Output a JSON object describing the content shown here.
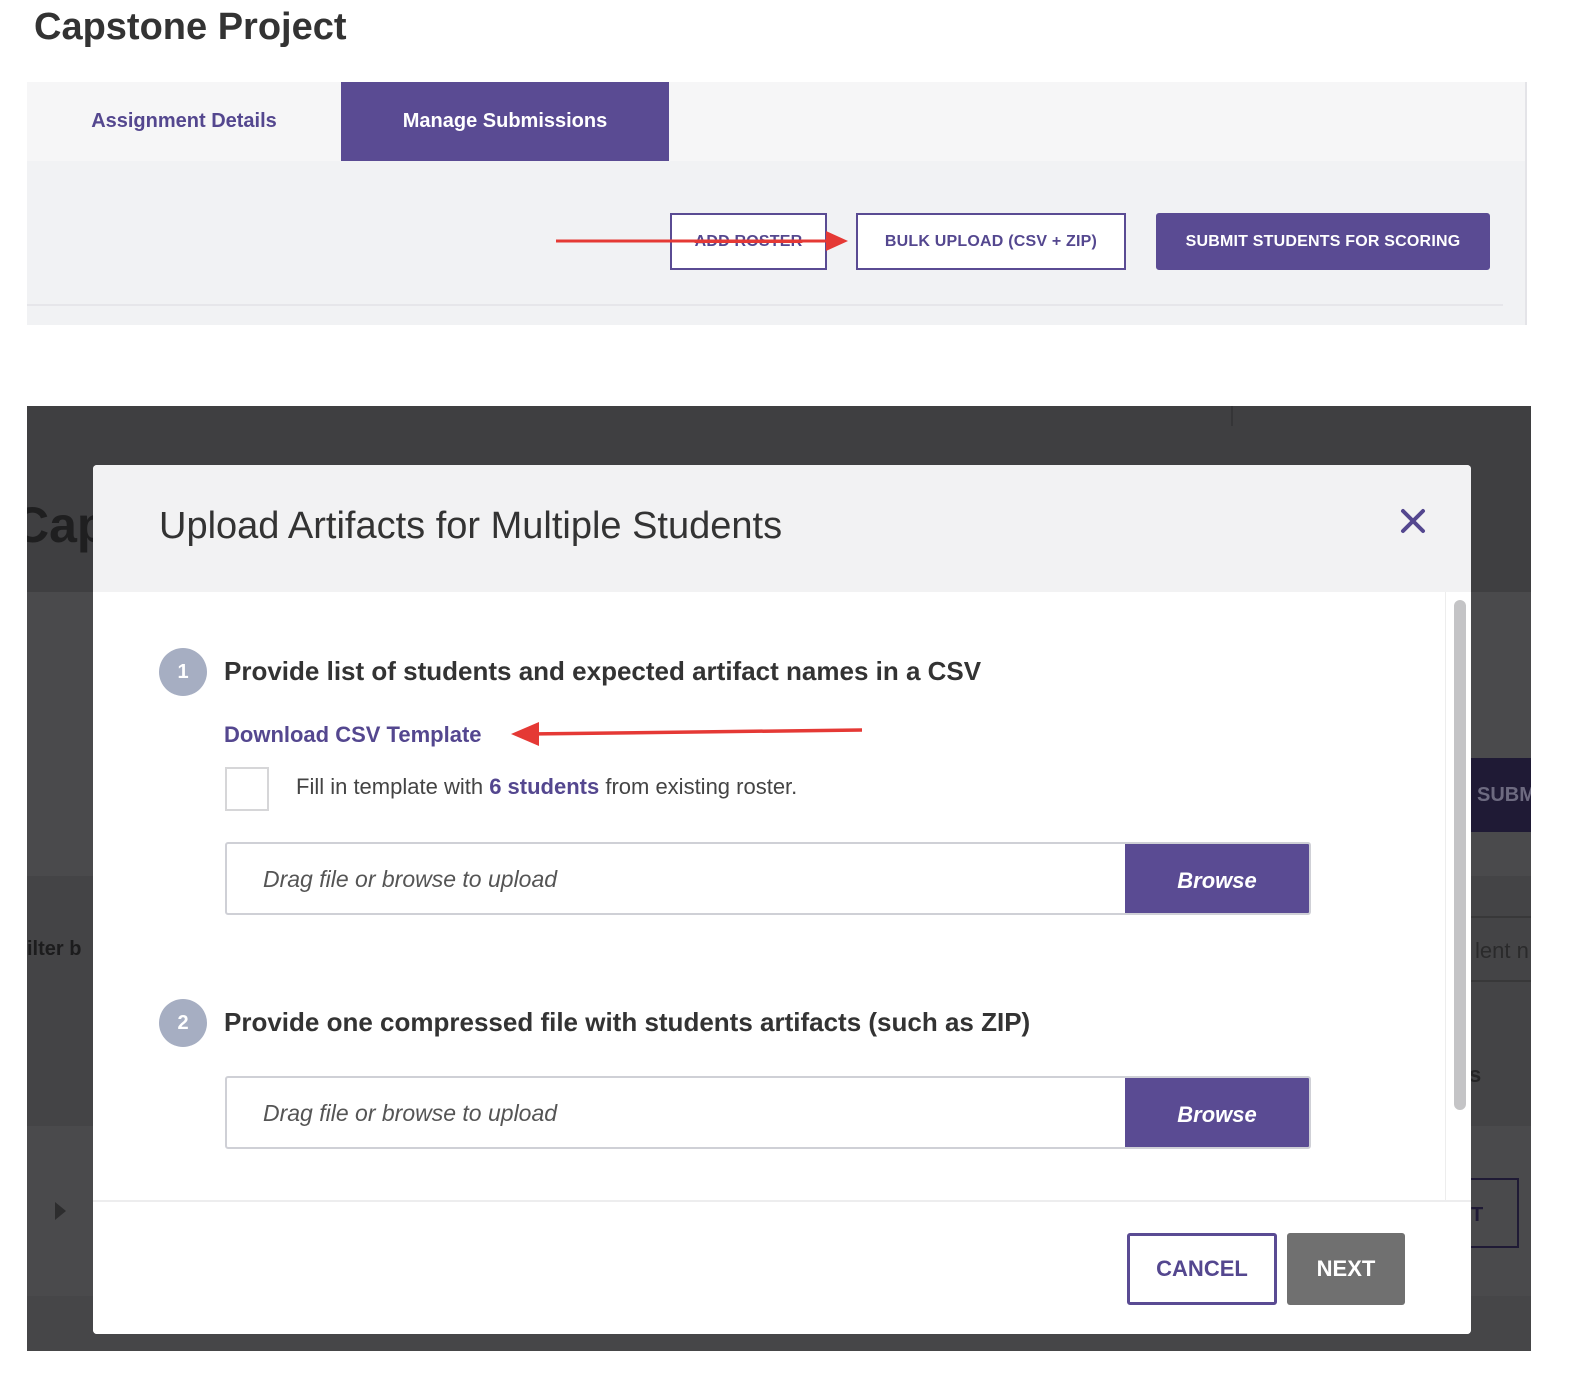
{
  "top": {
    "page_title": "Capstone Project",
    "tabs": [
      {
        "label": "Assignment Details"
      },
      {
        "label": "Manage Submissions"
      }
    ],
    "active_tab": "Manage Submissions",
    "toolbar": {
      "add_roster_label": "ADD ROSTER",
      "bulk_upload_label": "BULK UPLOAD (CSV + ZIP)",
      "submit_label": "SUBMIT STUDENTS FOR SCORING"
    }
  },
  "background": {
    "title_fragment": "Cap",
    "filter_fragment": "ilter b",
    "submit_fragment": "SUBM",
    "input_fragment": "lent n",
    "s_fragment": "s",
    "t_fragment": "T"
  },
  "modal": {
    "title": "Upload Artifacts for Multiple Students",
    "step1": {
      "number": "1",
      "text": "Provide list of students and expected artifact names in a CSV",
      "download_link": "Download CSV Template",
      "fill_prefix": "Fill in template with ",
      "fill_highlight": "6 students",
      "fill_suffix": " from existing roster.",
      "upload_placeholder": "Drag file or browse to upload",
      "browse_label": "Browse"
    },
    "step2": {
      "number": "2",
      "text": "Provide one compressed file with students artifacts (such as ZIP)",
      "upload_placeholder": "Drag file or browse to upload",
      "browse_label": "Browse"
    },
    "footer": {
      "cancel_label": "CANCEL",
      "next_label": "NEXT"
    }
  },
  "colors": {
    "brand_purple": "#5a4b93",
    "annotation_red": "#e53935",
    "disabled_gray": "#707070"
  },
  "icons": {
    "close": "close-icon",
    "annotation": "red-arrow-icon"
  }
}
